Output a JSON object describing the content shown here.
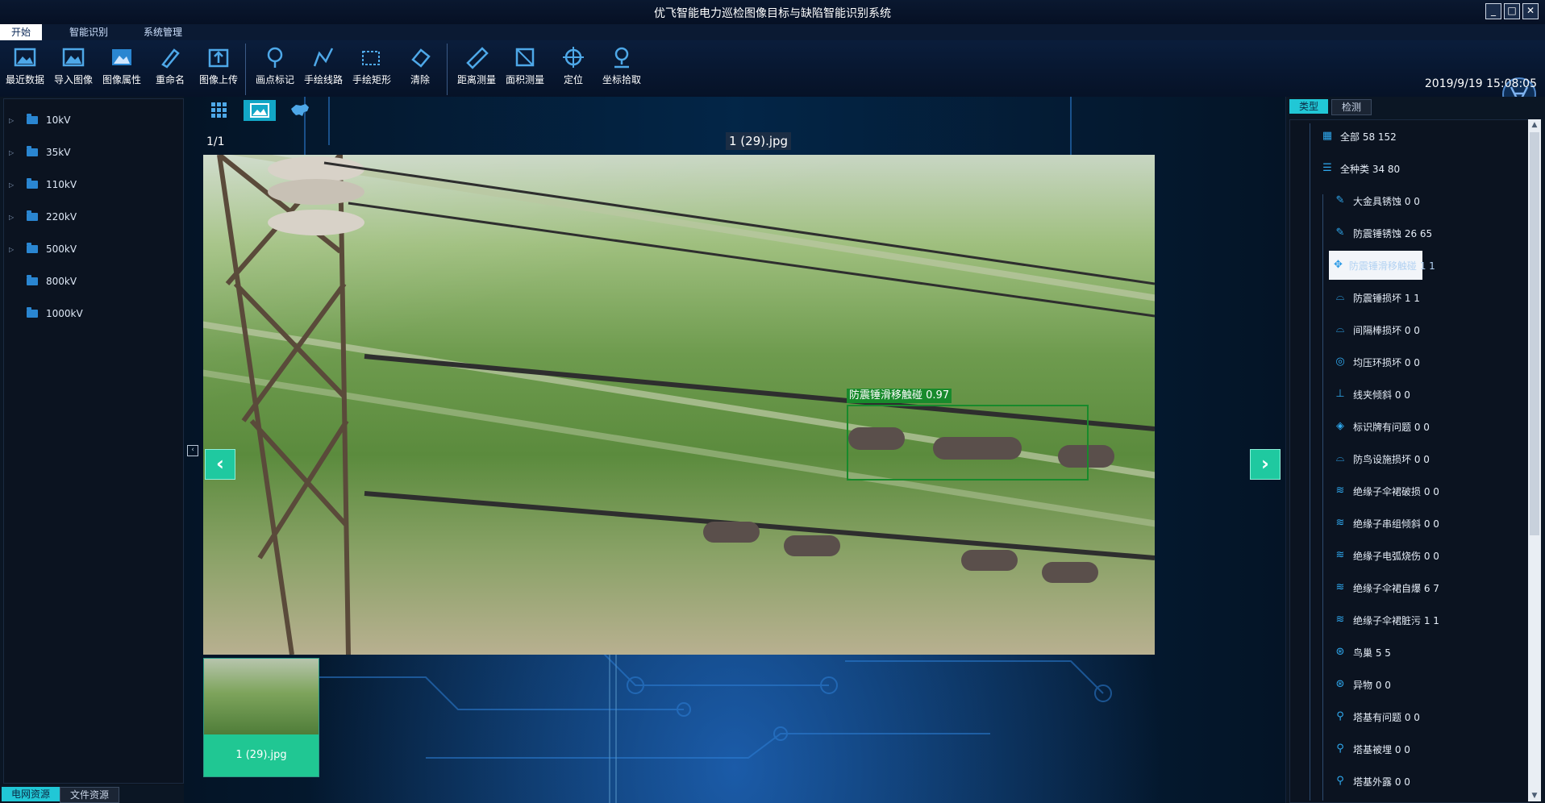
{
  "app": {
    "title": "优飞智能电力巡检图像目标与缺陷智能识别系统",
    "window_buttons": [
      "_",
      "□",
      "✕"
    ],
    "datetime": "2019/9/19 15:08:05"
  },
  "menu_tabs": [
    {
      "label": "开始",
      "active": true
    },
    {
      "label": "智能识别",
      "active": false
    },
    {
      "label": "系统管理",
      "active": false
    }
  ],
  "toolbar": {
    "groups": [
      [
        {
          "label": "最近数据",
          "icon": "image-icon"
        },
        {
          "label": "导入图像",
          "icon": "image-import-icon"
        },
        {
          "label": "图像属性",
          "icon": "image-properties-icon"
        },
        {
          "label": "重命名",
          "icon": "rename-pen-icon"
        },
        {
          "label": "图像上传",
          "icon": "upload-icon"
        }
      ],
      [
        {
          "label": "画点标记",
          "icon": "pin-icon"
        },
        {
          "label": "手绘线路",
          "icon": "polyline-icon"
        },
        {
          "label": "手绘矩形",
          "icon": "rectangle-icon"
        },
        {
          "label": "清除",
          "icon": "eraser-icon"
        }
      ],
      [
        {
          "label": "距离测量",
          "icon": "ruler-icon"
        },
        {
          "label": "面积测量",
          "icon": "area-icon"
        },
        {
          "label": "定位",
          "icon": "crosshair-icon"
        },
        {
          "label": "坐标拾取",
          "icon": "map-pin-icon"
        }
      ]
    ]
  },
  "left_panel": {
    "tree": [
      {
        "label": "10kV",
        "expandable": true
      },
      {
        "label": "35kV",
        "expandable": true
      },
      {
        "label": "110kV",
        "expandable": true
      },
      {
        "label": "220kV",
        "expandable": true
      },
      {
        "label": "500kV",
        "expandable": true
      },
      {
        "label": "800kV",
        "expandable": false
      },
      {
        "label": "1000kV",
        "expandable": false
      }
    ],
    "tabs": [
      {
        "label": "电网资源",
        "active": true
      },
      {
        "label": "文件资源",
        "active": false
      }
    ]
  },
  "viewer": {
    "view_icons": [
      "grid-icon",
      "image-icon",
      "map-icon"
    ],
    "counter": "1/1",
    "filename": "1 (29).jpg",
    "detection": {
      "label": "防震锤滑移触碰",
      "score": "0.97"
    },
    "thumbnail": {
      "label": "1 (29).jpg"
    }
  },
  "right_panel": {
    "tabs": [
      {
        "label": "类型",
        "active": true
      },
      {
        "label": "检测",
        "active": false
      }
    ],
    "items": [
      {
        "label": "全部 58 152",
        "icon": "grid-icon",
        "level": 0,
        "selected": false
      },
      {
        "label": "全种类 34 80",
        "icon": "list-icon",
        "level": 0,
        "selected": false
      },
      {
        "label": "大金具锈蚀 0 0",
        "icon": "pen-icon",
        "level": 1,
        "selected": false
      },
      {
        "label": "防震锤锈蚀 26 65",
        "icon": "pen-icon",
        "level": 1,
        "selected": false
      },
      {
        "label": "防震锤滑移触碰 1 1",
        "icon": "move-icon",
        "level": 1,
        "selected": true
      },
      {
        "label": "防震锤损坏 1 1",
        "icon": "damper-icon",
        "level": 1,
        "selected": false
      },
      {
        "label": "间隔棒损坏 0 0",
        "icon": "spacer-icon",
        "level": 1,
        "selected": false
      },
      {
        "label": "均压环损坏 0 0",
        "icon": "ring-icon",
        "level": 1,
        "selected": false
      },
      {
        "label": "线夹倾斜 0 0",
        "icon": "clamp-icon",
        "level": 1,
        "selected": false
      },
      {
        "label": "标识牌有问题 0 0",
        "icon": "sign-icon",
        "level": 1,
        "selected": false
      },
      {
        "label": "防鸟设施损坏 0 0",
        "icon": "bird-guard-icon",
        "level": 1,
        "selected": false
      },
      {
        "label": "绝缘子伞裙破损 0 0",
        "icon": "insulator-icon",
        "level": 1,
        "selected": false
      },
      {
        "label": "绝缘子串组倾斜 0 0",
        "icon": "insulator-icon",
        "level": 1,
        "selected": false
      },
      {
        "label": "绝缘子电弧烧伤 0 0",
        "icon": "insulator-icon",
        "level": 1,
        "selected": false
      },
      {
        "label": "绝缘子伞裙自爆 6 7",
        "icon": "insulator-icon",
        "level": 1,
        "selected": false
      },
      {
        "label": "绝缘子伞裙脏污 1 1",
        "icon": "insulator-icon",
        "level": 1,
        "selected": false
      },
      {
        "label": "鸟巢 5 5",
        "icon": "nest-icon",
        "level": 1,
        "selected": false
      },
      {
        "label": "异物 0 0",
        "icon": "foreign-object-icon",
        "level": 1,
        "selected": false
      },
      {
        "label": "塔基有问题 0 0",
        "icon": "tower-icon",
        "level": 1,
        "selected": false
      },
      {
        "label": "塔基被埋 0 0",
        "icon": "tower-icon",
        "level": 1,
        "selected": false
      },
      {
        "label": "塔基外露 0 0",
        "icon": "tower-icon",
        "level": 1,
        "selected": false
      }
    ]
  },
  "colors": {
    "accent": "#21c7d6",
    "detection_box": "#188a2c",
    "nav_button": "#1fc9a0",
    "selected_row_bg": "#f2f5f9"
  }
}
